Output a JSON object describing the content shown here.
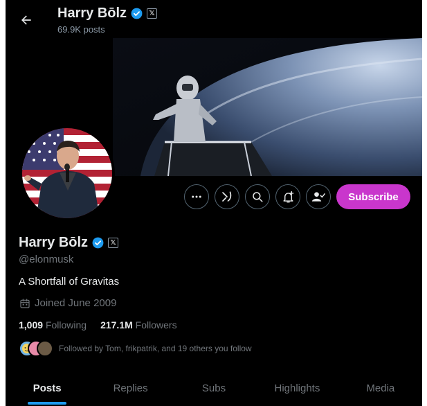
{
  "header": {
    "name": "Harry Bōlz",
    "posts_count": "69.9K posts"
  },
  "icons": {
    "back": "arrow-left-icon",
    "verified": "verified-badge-icon",
    "affiliate": "x-affiliate-badge-icon",
    "more": "more-icon",
    "grok": "grok-icon",
    "search": "search-icon",
    "notify": "bell-plus-icon",
    "following": "person-check-icon",
    "calendar": "calendar-icon"
  },
  "actions": {
    "subscribe_label": "Subscribe"
  },
  "profile": {
    "name": "Harry Bōlz",
    "handle": "@elonmusk",
    "bio": "A Shortfall of Gravitas",
    "joined": "Joined June 2009",
    "following_count": "1,009",
    "following_label": "Following",
    "followers_count": "217.1M",
    "followers_label": "Followers",
    "followed_by": "Followed by Tom, frikpatrik, and 19 others you follow"
  },
  "tabs": [
    {
      "label": "Posts",
      "active": true
    },
    {
      "label": "Replies",
      "active": false
    },
    {
      "label": "Subs",
      "active": false
    },
    {
      "label": "Highlights",
      "active": false
    },
    {
      "label": "Media",
      "active": false
    }
  ],
  "colors": {
    "background": "#000000",
    "subscribe": "#c936cc",
    "verified": "#1d9bf0",
    "accent": "#1d9bf0"
  }
}
